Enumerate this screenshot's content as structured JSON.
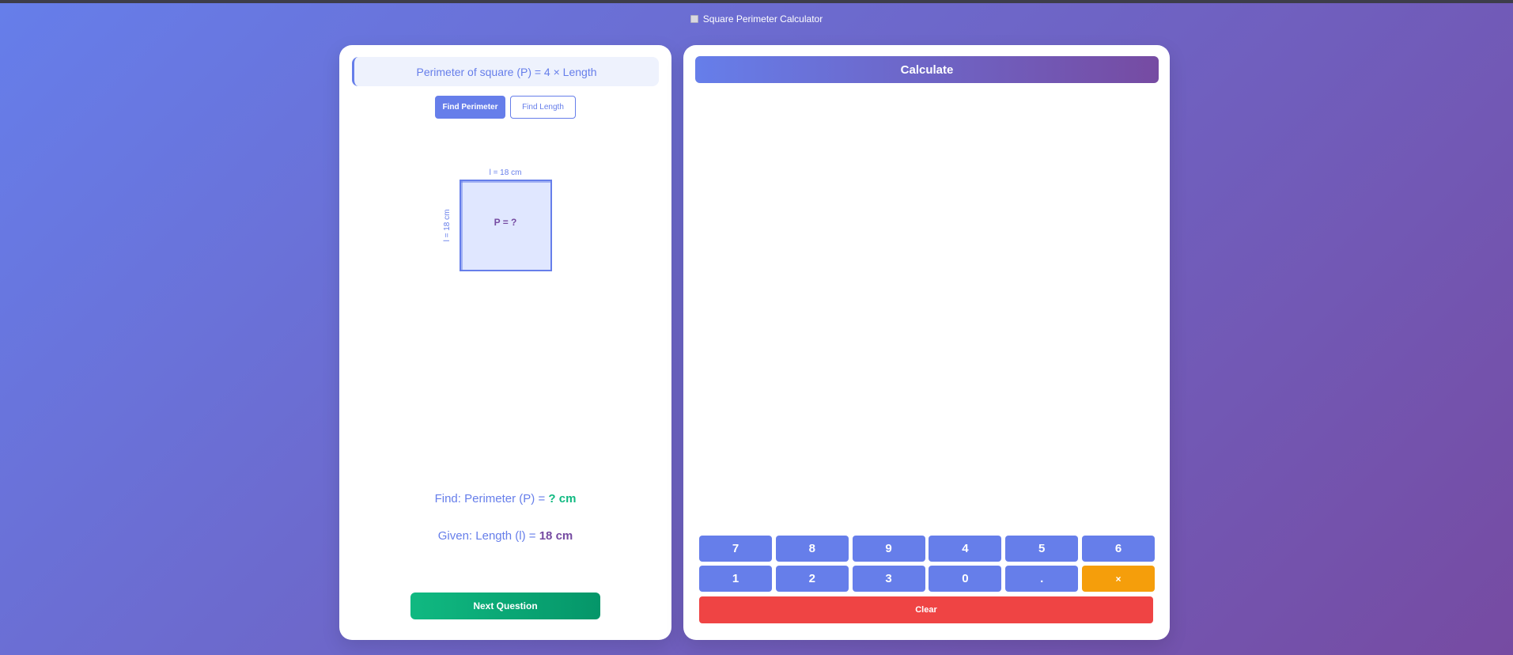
{
  "window": {
    "title": "Square Perimeter Calculator",
    "icon": "square-icon"
  },
  "left": {
    "formula": "Perimeter of square (P) = 4 × Length",
    "modes": {
      "find_perimeter": "Find Perimeter",
      "find_length": "Find Length"
    },
    "diagram": {
      "top_label": "l = 18 cm",
      "side_label": "l = 18 cm",
      "center_label": "P = ?"
    },
    "find": {
      "prefix": "Find: Perimeter (P) = ",
      "value": "? cm"
    },
    "given": {
      "prefix": "Given: Length (l) = ",
      "value": "18 cm"
    },
    "next_label": "Next Question"
  },
  "right": {
    "header": "Calculate",
    "keys": [
      "7",
      "8",
      "9",
      "4",
      "5",
      "6",
      "1",
      "2",
      "3",
      "0",
      ".",
      "×"
    ],
    "clear_label": "Clear"
  },
  "colors": {
    "accent": "#667eea",
    "accent2": "#764ba2",
    "success": "#10b981",
    "danger": "#ef4444",
    "warning": "#f59e0b"
  }
}
